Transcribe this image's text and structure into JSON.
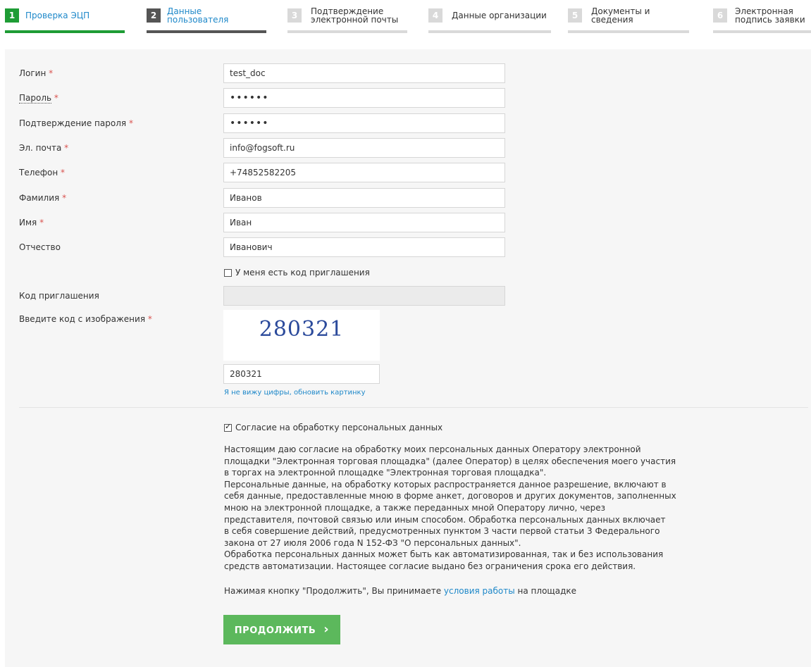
{
  "steps": [
    {
      "num": "1",
      "line1": "Проверка ЭЦП",
      "line2": ""
    },
    {
      "num": "2",
      "line1": "Данные",
      "line2": "пользователя"
    },
    {
      "num": "3",
      "line1": "Подтверждение",
      "line2": "электронной почты"
    },
    {
      "num": "4",
      "line1": "Данные организации",
      "line2": ""
    },
    {
      "num": "5",
      "line1": "Документы и",
      "line2": "сведения"
    },
    {
      "num": "6",
      "line1": "Электронная",
      "line2": "подпись заявки"
    }
  ],
  "form": {
    "login": {
      "label": "Логин",
      "value": "test_doc"
    },
    "password": {
      "label": "Пароль",
      "value": "••••••"
    },
    "password_confirm": {
      "label": "Подтверждение пароля",
      "value": "••••••"
    },
    "email": {
      "label": "Эл. почта",
      "value": "info@fogsoft.ru"
    },
    "phone": {
      "label": "Телефон",
      "value": "+74852582205"
    },
    "surname": {
      "label": "Фамилия",
      "value": "Иванов"
    },
    "name": {
      "label": "Имя",
      "value": "Иван"
    },
    "patronymic": {
      "label": "Отчество",
      "value": "Иванович"
    },
    "invite_checkbox": {
      "label": "У меня есть код приглашения",
      "checked": false
    },
    "invite_code": {
      "label": "Код приглашения",
      "value": ""
    },
    "captcha": {
      "label": "Введите код с изображения",
      "image_text": "280321",
      "value": "280321",
      "refresh_link": "Я не вижу цифры, обновить картинку"
    }
  },
  "required_mark": "*",
  "consent": {
    "checkbox_label": "Согласие на обработку персональных данных",
    "checked": true,
    "lines": [
      "Настоящим даю согласие на обработку моих персональных данных Оператору электронной",
      "площадки \"Электронная торговая площадка\" (далее Оператор) в целях обеспечения моего участия",
      "в торгах на электронной площадке \"Электронная торговая площадка\".",
      "Персональные данные, на обработку которых распространяется данное разрешение, включают в",
      "себя данные, предоставленные мною в форме анкет, договоров и других документов, заполненных",
      "мною на электронной площадке, а также переданных мной Оператору лично, через",
      "представителя, почтовой связью или иным способом. Обработка персональных данных включает",
      "в себя совершение действий, предусмотренных пунктом 3 части первой статьи 3 Федерального",
      "закона от 27 июля 2006 года N 152-ФЗ \"О персональных данных\".",
      "Обработка персональных данных может быть как автоматизированная, так и без использования",
      "средств автоматизации. Настоящее согласие выдано без ограничения срока его действия."
    ],
    "terms_prefix": "Нажимая кнопку \"Продолжить\", Вы принимаете",
    "terms_link": "условия работы",
    "terms_suffix": "на площадке"
  },
  "continue_button": "ПРОДОЛЖИТЬ",
  "continue_arrow": "›",
  "colors": {
    "active": "#1e9c35",
    "done": "#555555",
    "inactive": "#d9d9d9",
    "button": "#5cb85c",
    "link": "#1e88c9",
    "required": "#d9534f"
  }
}
